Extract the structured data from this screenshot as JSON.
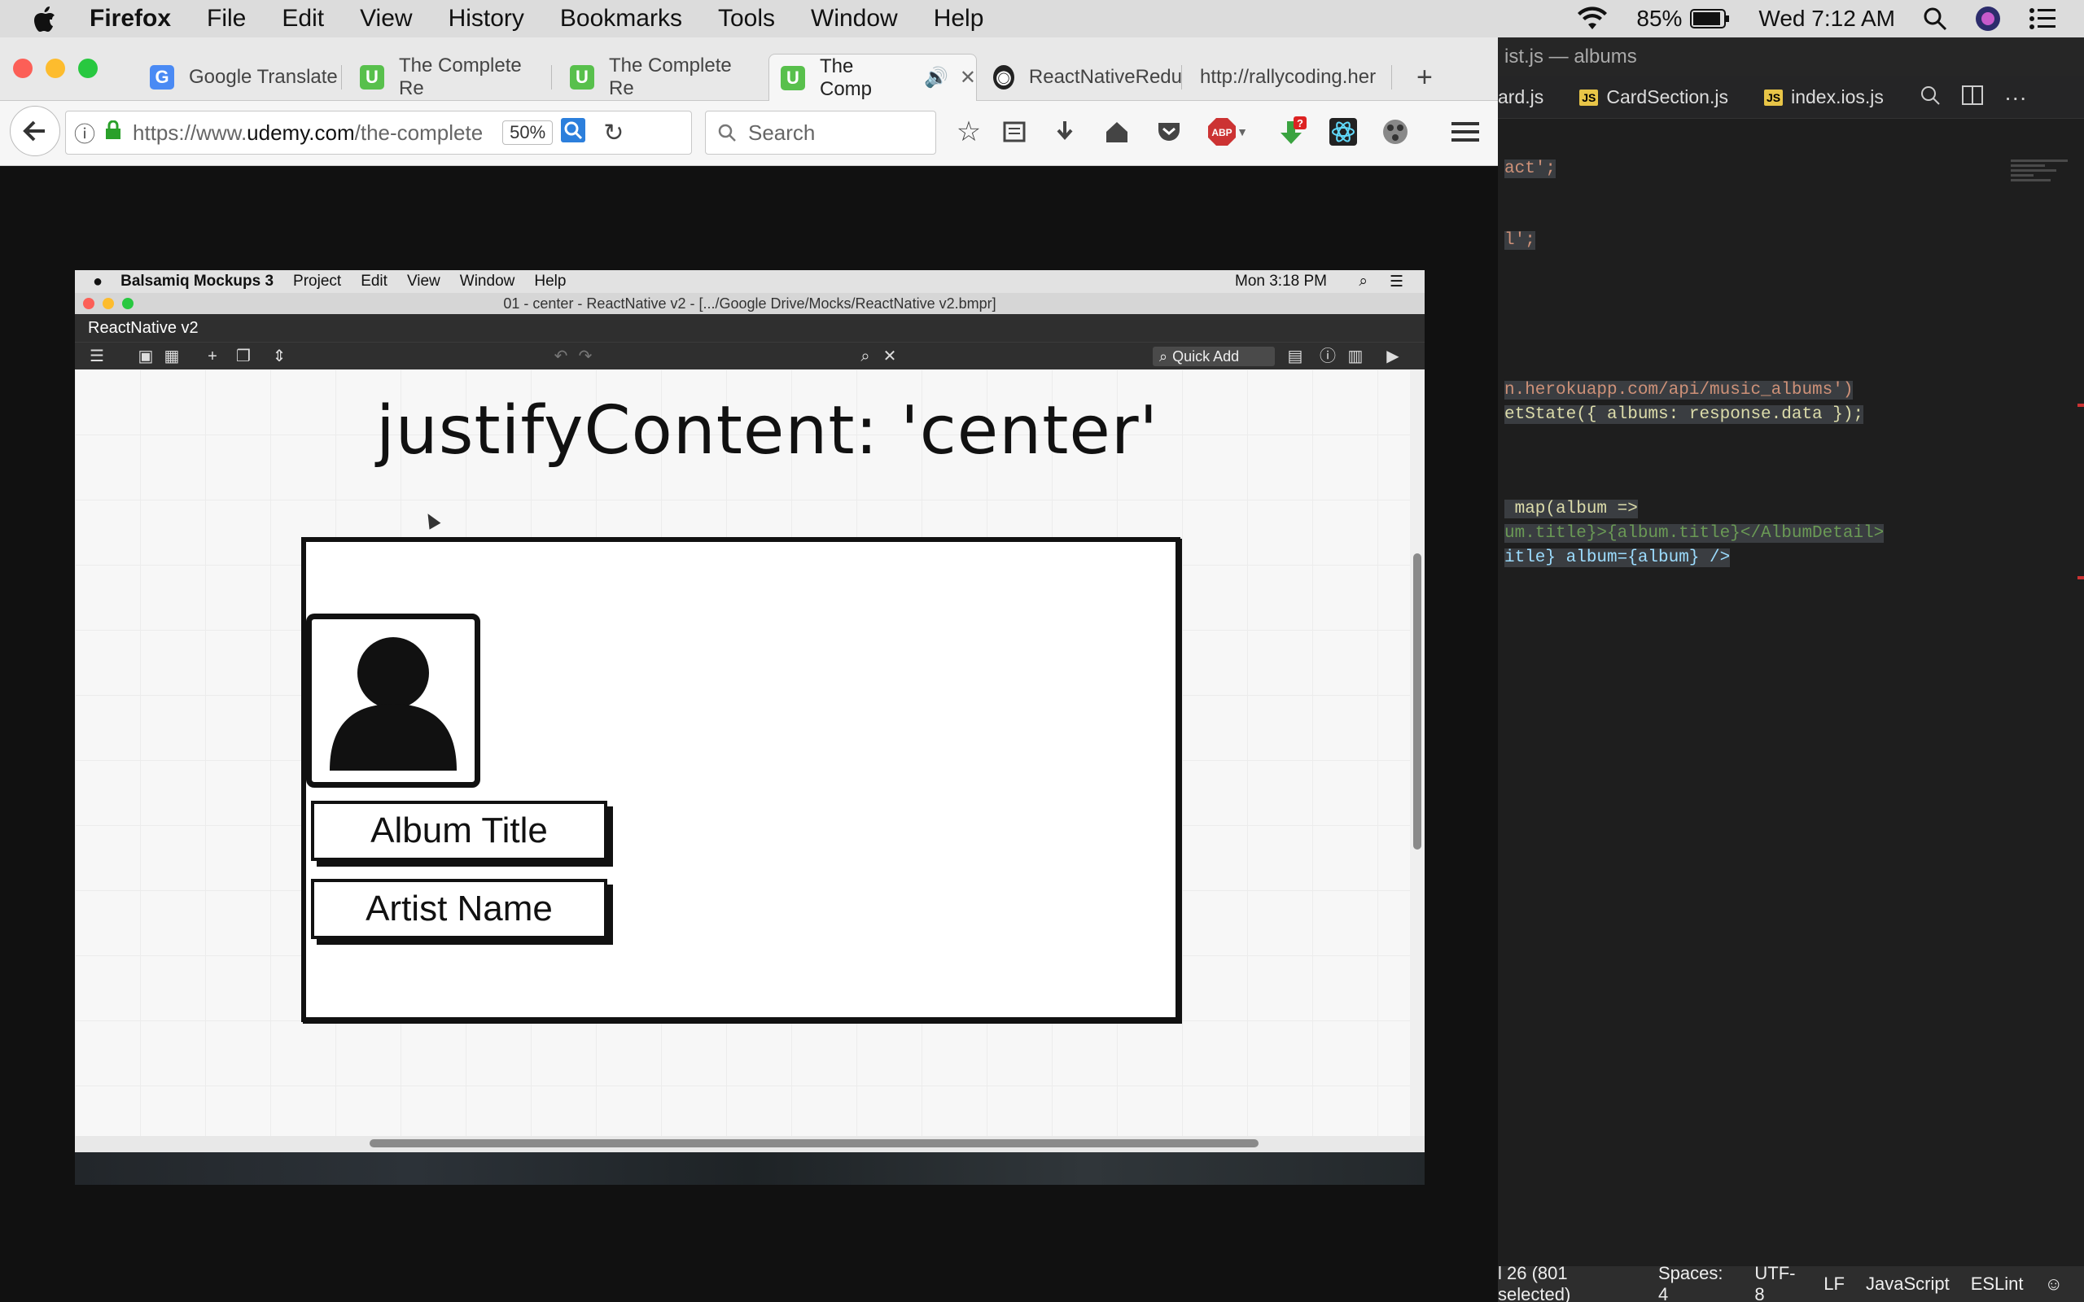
{
  "mac_menubar": {
    "items": [
      "Firefox",
      "File",
      "Edit",
      "View",
      "History",
      "Bookmarks",
      "Tools",
      "Window",
      "Help"
    ],
    "battery": "85%",
    "clock": "Wed 7:12 AM"
  },
  "firefox": {
    "tabs": [
      {
        "label": "Google Translate",
        "icon": "google-translate-icon"
      },
      {
        "label": "The Complete Re",
        "icon": "udemy-icon"
      },
      {
        "label": "The Complete Re",
        "icon": "udemy-icon"
      },
      {
        "label": "The Comp",
        "icon": "udemy-icon",
        "active": true
      },
      {
        "label": "ReactNativeRedu",
        "icon": "github-icon"
      },
      {
        "label": "http://rallycoding.her",
        "icon": ""
      }
    ],
    "url_prefix": "https://www.",
    "url_domain": "udemy.com",
    "url_path": "/the-complete",
    "zoom": "50%",
    "search_placeholder": "Search",
    "abp_label": "ABP",
    "download_badge": "?"
  },
  "balsamiq": {
    "menu": [
      "Balsamiq Mockups 3",
      "Project",
      "Edit",
      "View",
      "Window",
      "Help"
    ],
    "clock": "Mon 3:18 PM",
    "window_title": "01 - center - ReactNative v2 - [.../Google Drive/Mocks/ReactNative v2.bmpr]",
    "project_name": "ReactNative v2",
    "quick_add_placeholder": "Quick Add",
    "mockup": {
      "heading": "justifyContent: 'center'",
      "album_title_label": "Album Title",
      "artist_name_label": "Artist Name"
    }
  },
  "editor": {
    "title": "ist.js — albums",
    "tabs": [
      "ard.js",
      "CardSection.js",
      "index.ios.js"
    ],
    "code_lines": [
      {
        "text": "act';",
        "cls": "k-str"
      },
      {
        "text": "l';",
        "cls": "k-str"
      },
      {
        "text": "n.herokuapp.com/api/music_albums')",
        "cls": "k-str"
      },
      {
        "text": "etState({ albums: response.data });",
        "cls": "k-fn"
      },
      {
        "text": " map(album =>",
        "cls": "k-fn"
      },
      {
        "text": "um.title}>{album.title}</AlbumDetail>",
        "cls": "k-gr"
      },
      {
        "text": "itle} album={album} />",
        "cls": "k-var"
      }
    ],
    "status": {
      "position": "l 26 (801 selected)",
      "spaces": "Spaces: 4",
      "encoding": "UTF-8",
      "line_ending": "LF",
      "language": "JavaScript",
      "linter": "ESLint"
    }
  }
}
